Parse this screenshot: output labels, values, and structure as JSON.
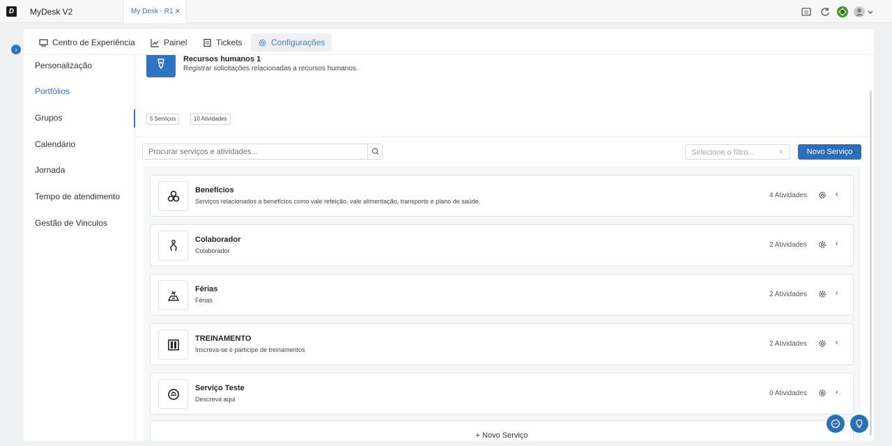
{
  "window": {
    "logo_letter": "D",
    "app_title": "MyDesk V2",
    "tab_label": "My Desk - R1",
    "tab_close": "×"
  },
  "nav": {
    "items": [
      {
        "label": "Centro de Experiência",
        "icon": "monitor-icon"
      },
      {
        "label": "Painel",
        "icon": "chart-icon"
      },
      {
        "label": "Tickets",
        "icon": "ticket-icon"
      },
      {
        "label": "Configurações",
        "icon": "gear-icon",
        "active": true
      }
    ]
  },
  "sidebar": {
    "items": [
      {
        "label": "Personalização"
      },
      {
        "label": "Portfólios",
        "active": true
      },
      {
        "label": "Grupos"
      },
      {
        "label": "Calendário"
      },
      {
        "label": "Jornada"
      },
      {
        "label": "Tempo de atendimento"
      },
      {
        "label": "Gestão de Vinculos"
      }
    ]
  },
  "portfolio": {
    "name": "Recursos humanos 1",
    "description": "Registrar solicitações relacionadas a recursos humanos.",
    "services_chip": "5 Serviços",
    "activities_chip": "10 Atividades"
  },
  "toolbar": {
    "search_placeholder": "Procurar serviços e atividades...",
    "filter_placeholder": "Selecione o filtro...",
    "new_service_label": "Novo Serviço"
  },
  "services": [
    {
      "title": "Benefícios",
      "description": "Serviços relacionados a benefícios como vale refeição, vale alimentação, transporte e plano de saúde.",
      "count": "4 Atividades",
      "icon": "benefits-icon"
    },
    {
      "title": "Colaborador",
      "description": "Colaborador",
      "count": "2 Atividades",
      "icon": "person-icon"
    },
    {
      "title": "Férias",
      "description": "Férias",
      "count": "2 Atividades",
      "icon": "vacation-icon"
    },
    {
      "title": "TREINAMENTO",
      "description": "Inscreva-se e participe de treinamentos",
      "count": "2 Atividades",
      "icon": "training-icon"
    },
    {
      "title": "Serviço Teste",
      "description": "Descreva aqui",
      "count": "0 Atividades",
      "icon": "service-icon"
    }
  ],
  "add_service_label": "+ Novo Serviço",
  "colors": {
    "accent": "#2f74c0",
    "primary_button": "#2b6fb8",
    "background": "#f0f1f3"
  }
}
